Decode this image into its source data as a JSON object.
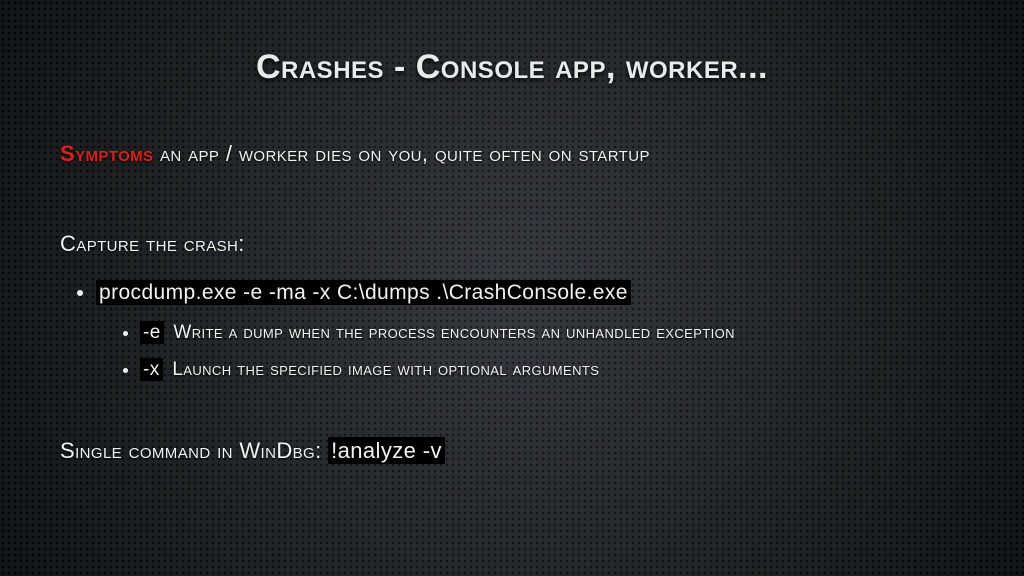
{
  "title": "Crashes - Console app, worker...",
  "symptoms": {
    "label": "Symptoms",
    "text": " an app / worker dies on you, quite often on startup"
  },
  "capture_heading": "Capture the crash:",
  "procdump_cmd": "procdump.exe -e -ma -x C:\\dumps .\\CrashConsole.exe",
  "flags": [
    {
      "flag": "-e",
      "desc": " Write a dump when the process encounters an unhandled exception"
    },
    {
      "flag": "-x",
      "desc": " Launch the specified image with optional arguments"
    }
  ],
  "windbg_line_prefix": "Single command in WinDbg: ",
  "windbg_cmd": "!analyze -v"
}
